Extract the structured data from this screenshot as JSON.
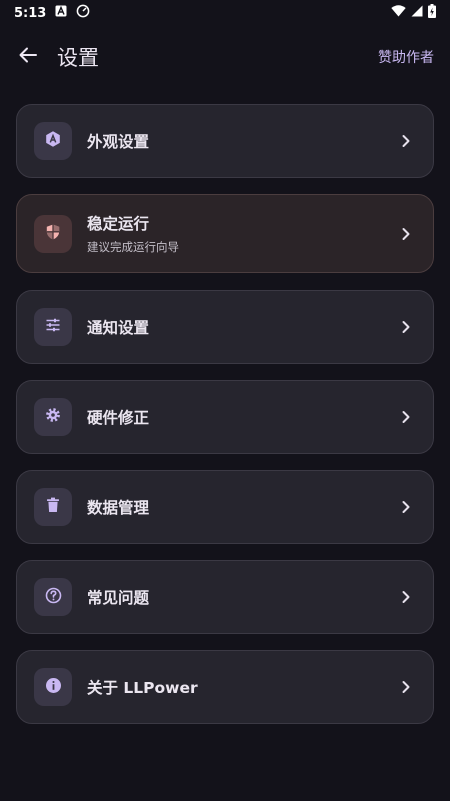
{
  "status_bar": {
    "time": "5:13"
  },
  "app_bar": {
    "title": "设置",
    "sponsor_label": "赞助作者"
  },
  "items": [
    {
      "title": "外观设置"
    },
    {
      "title": "稳定运行",
      "subtitle": "建议完成运行向导"
    },
    {
      "title": "通知设置"
    },
    {
      "title": "硬件修正"
    },
    {
      "title": "数据管理"
    },
    {
      "title": "常见问题"
    },
    {
      "title": "关于 LLPower"
    }
  ],
  "colors": {
    "accent": "#c9b8f2",
    "warning": "#f5b3b0",
    "background": "#13121a",
    "card": "#26252e"
  }
}
